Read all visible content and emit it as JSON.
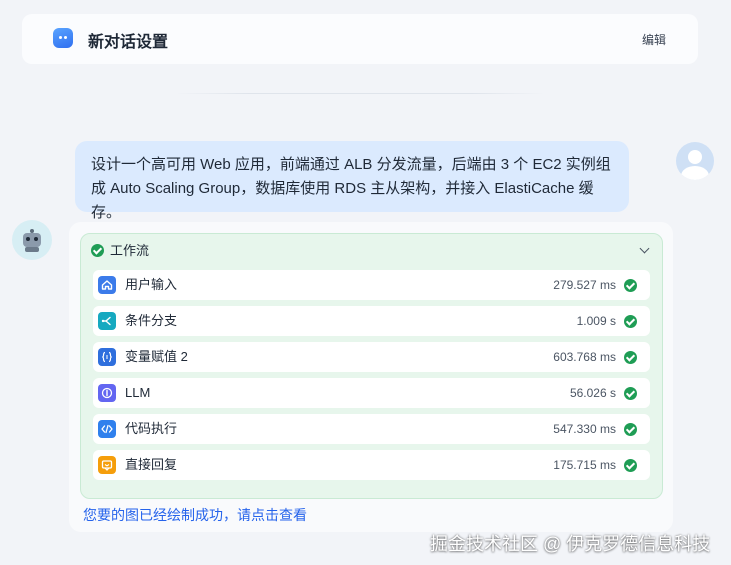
{
  "header": {
    "title": "新对话设置",
    "edit_label": "编辑",
    "app_icon": "chat-bot-icon"
  },
  "user_message": {
    "text": "设计一个高可用 Web 应用，前端通过 ALB 分发流量，后端由 3 个 EC2 实例组成 Auto Scaling Group，数据库使用 RDS 主从架构，并接入 ElastiCache 缓存。"
  },
  "workflow": {
    "title": "工作流",
    "status": "success",
    "steps": [
      {
        "label": "用户输入",
        "time": "279.527 ms",
        "icon": "home-icon",
        "color": "#3b7bea"
      },
      {
        "label": "条件分支",
        "time": "1.009 s",
        "icon": "branch-icon",
        "color": "#16a9c0"
      },
      {
        "label": "变量赋值 2",
        "time": "603.768 ms",
        "icon": "variable-icon",
        "color": "#2f6fdd"
      },
      {
        "label": "LLM",
        "time": "56.026 s",
        "icon": "llm-icon",
        "color": "#6366f1"
      },
      {
        "label": "代码执行",
        "time": "547.330 ms",
        "icon": "code-icon",
        "color": "#2f80ed"
      },
      {
        "label": "直接回复",
        "time": "175.715 ms",
        "icon": "reply-icon",
        "color": "#f59e0b"
      }
    ]
  },
  "result_text": "您要的图已经绘制成功，请点击查看",
  "watermark": "掘金技术社区 @ 伊克罗德信息科技",
  "colors": {
    "accent": "#2563eb",
    "success": "#1f9d55",
    "user_bubble": "#dbeafe",
    "workflow_bg": "#e7f6ec"
  }
}
